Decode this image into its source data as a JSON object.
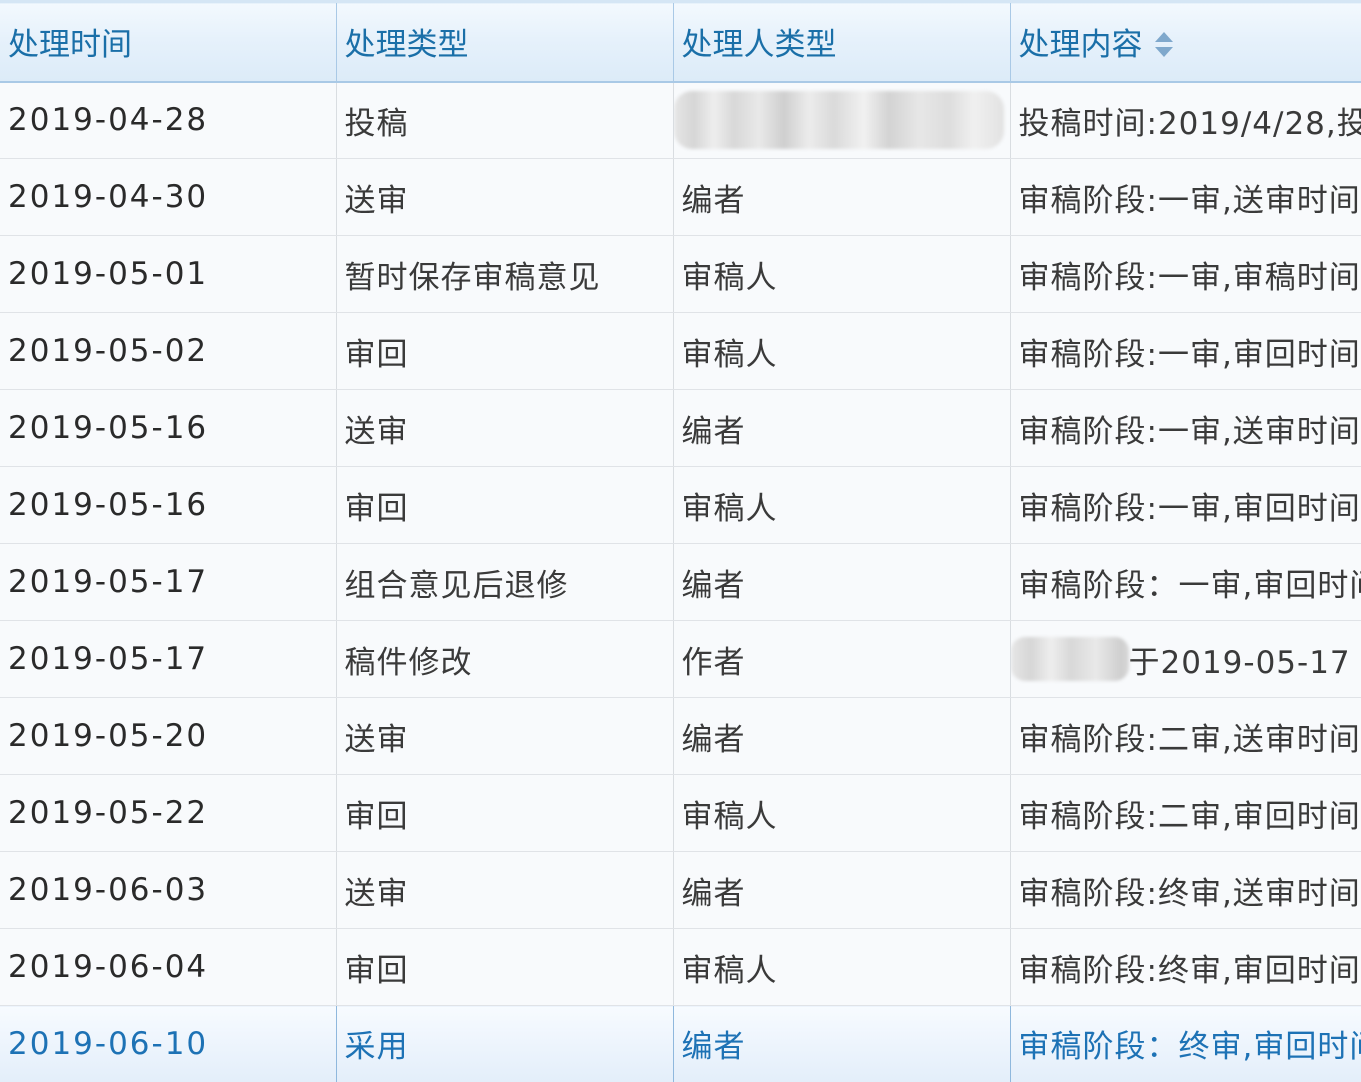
{
  "headers": {
    "time": "处理时间",
    "type": "处理类型",
    "handler_type": "处理人类型",
    "content": "处理内容"
  },
  "rows": [
    {
      "time": "2019-04-28",
      "type": "投稿",
      "handler_type": "",
      "content": "投稿时间:2019/4/28,投"
    },
    {
      "time": "2019-04-30",
      "type": "送审",
      "handler_type": "编者",
      "content": "审稿阶段:一审,送审时间"
    },
    {
      "time": "2019-05-01",
      "type": "暂时保存审稿意见",
      "handler_type": "审稿人",
      "content": "审稿阶段:一审,审稿时间"
    },
    {
      "time": "2019-05-02",
      "type": "审回",
      "handler_type": "审稿人",
      "content": "审稿阶段:一审,审回时间"
    },
    {
      "time": "2019-05-16",
      "type": "送审",
      "handler_type": "编者",
      "content": "审稿阶段:一审,送审时间"
    },
    {
      "time": "2019-05-16",
      "type": "审回",
      "handler_type": "审稿人",
      "content": "审稿阶段:一审,审回时间"
    },
    {
      "time": "2019-05-17",
      "type": "组合意见后退修",
      "handler_type": "编者",
      "content": "审稿阶段：一审,审回时间"
    },
    {
      "time": "2019-05-17",
      "type": "稿件修改",
      "handler_type": "作者",
      "content": "于2019-05-17"
    },
    {
      "time": "2019-05-20",
      "type": "送审",
      "handler_type": "编者",
      "content": "审稿阶段:二审,送审时间"
    },
    {
      "time": "2019-05-22",
      "type": "审回",
      "handler_type": "审稿人",
      "content": "审稿阶段:二审,审回时间"
    },
    {
      "time": "2019-06-03",
      "type": "送审",
      "handler_type": "编者",
      "content": "审稿阶段:终审,送审时间"
    },
    {
      "time": "2019-06-04",
      "type": "审回",
      "handler_type": "审稿人",
      "content": "审稿阶段:终审,审回时间"
    },
    {
      "time": "2019-06-10",
      "type": "采用",
      "handler_type": "编者",
      "content": "审稿阶段：终审,审回时间"
    }
  ],
  "selected_row": 12,
  "sort_icon": "sort-both-icon",
  "colors": {
    "header_text": "#1a6fa8",
    "selected_text": "#1d72b5",
    "cell_text": "#3a3a3a",
    "row_bg": "#f8fafc"
  }
}
